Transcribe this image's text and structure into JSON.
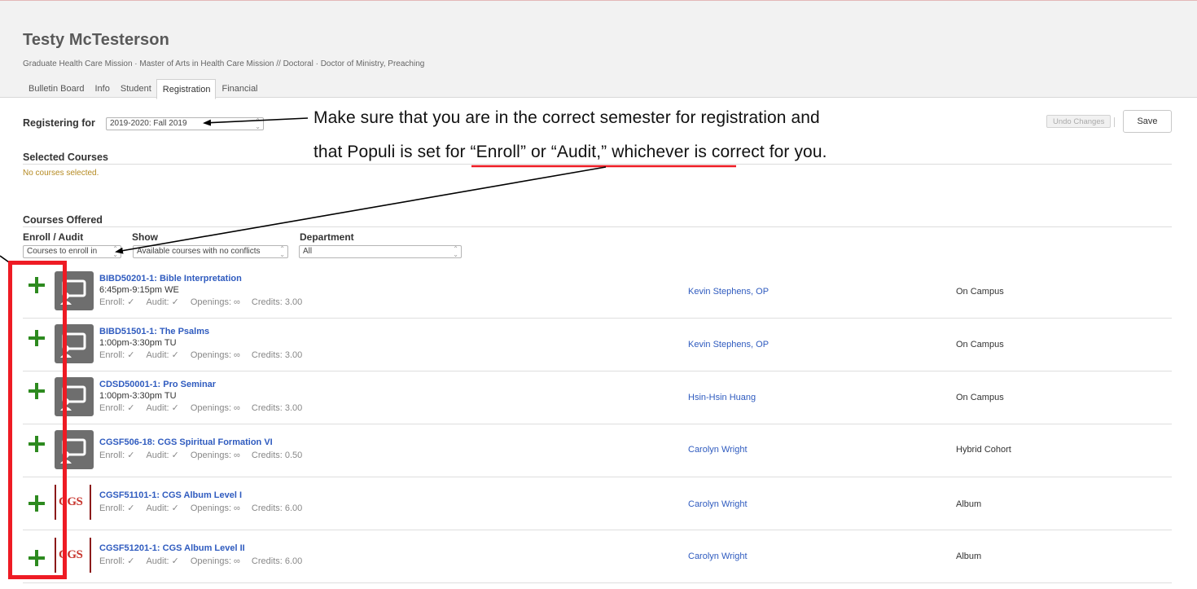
{
  "student": {
    "name": "Testy McTesterson",
    "programs": "Graduate Health Care Mission · Master of Arts in Health Care Mission  //  Doctoral · Doctor of Ministry, Preaching"
  },
  "tabs": [
    {
      "label": "Bulletin Board",
      "active": false
    },
    {
      "label": "Info",
      "active": false
    },
    {
      "label": "Student",
      "active": false
    },
    {
      "label": "Registration",
      "active": true
    },
    {
      "label": "Financial",
      "active": false
    }
  ],
  "registration": {
    "label": "Registering for",
    "term_value": "2019-2020: Fall 2019",
    "undo_label": "Undo Changes",
    "save_label": "Save"
  },
  "selected_courses": {
    "title": "Selected Courses",
    "empty_text": "No courses selected."
  },
  "courses_offered": {
    "title": "Courses Offered",
    "filters": {
      "enroll_audit_label": "Enroll / Audit",
      "enroll_audit_value": "Courses to enroll in",
      "show_label": "Show",
      "show_value": "Available courses with no conflicts",
      "department_label": "Department",
      "department_value": "All"
    },
    "meta_labels": {
      "enroll": "Enroll: ✓",
      "audit": "Audit: ✓",
      "openings": "Openings: ∞"
    },
    "rows": [
      {
        "title": "BIBD50201-1: Bible Interpretation",
        "time": "6:45pm-9:15pm WE",
        "credits": "Credits: 3.00",
        "instructor": "Kevin Stephens, OP",
        "location": "On Campus",
        "thumb": "presentation-icon"
      },
      {
        "title": "BIBD51501-1: The Psalms",
        "time": "1:00pm-3:30pm TU",
        "credits": "Credits: 3.00",
        "instructor": "Kevin Stephens, OP",
        "location": "On Campus",
        "thumb": "presentation-icon"
      },
      {
        "title": "CDSD50001-1: Pro Seminar",
        "time": "1:00pm-3:30pm TU",
        "credits": "Credits: 3.00",
        "instructor": "Hsin-Hsin Huang",
        "location": "On Campus",
        "thumb": "presentation-icon"
      },
      {
        "title": "CGSF506-18: CGS Spiritual Formation VI",
        "time": "",
        "credits": "Credits: 0.50",
        "instructor": "Carolyn Wright",
        "location": "Hybrid Cohort",
        "thumb": "presentation-icon"
      },
      {
        "title": "CGSF51101-1: CGS Album Level I",
        "time": "",
        "credits": "Credits: 6.00",
        "instructor": "Carolyn Wright",
        "location": "Album",
        "thumb": "cgs-logo"
      },
      {
        "title": "CGSF51201-1: CGS Album Level II",
        "time": "",
        "credits": "Credits: 6.00",
        "instructor": "Carolyn Wright",
        "location": "Album",
        "thumb": "cgs-logo"
      }
    ]
  },
  "cgs_logo_text": "CGS",
  "annotation": {
    "line1": "Make sure that you are in the correct semester for registration and",
    "line2_prefix": "that Populi is set  for “",
    "line2_underlined": "Enroll” or “Audit",
    "line2_suffix": ",” whichever is correct for you.",
    "highlight_color": "#ee1b24"
  }
}
